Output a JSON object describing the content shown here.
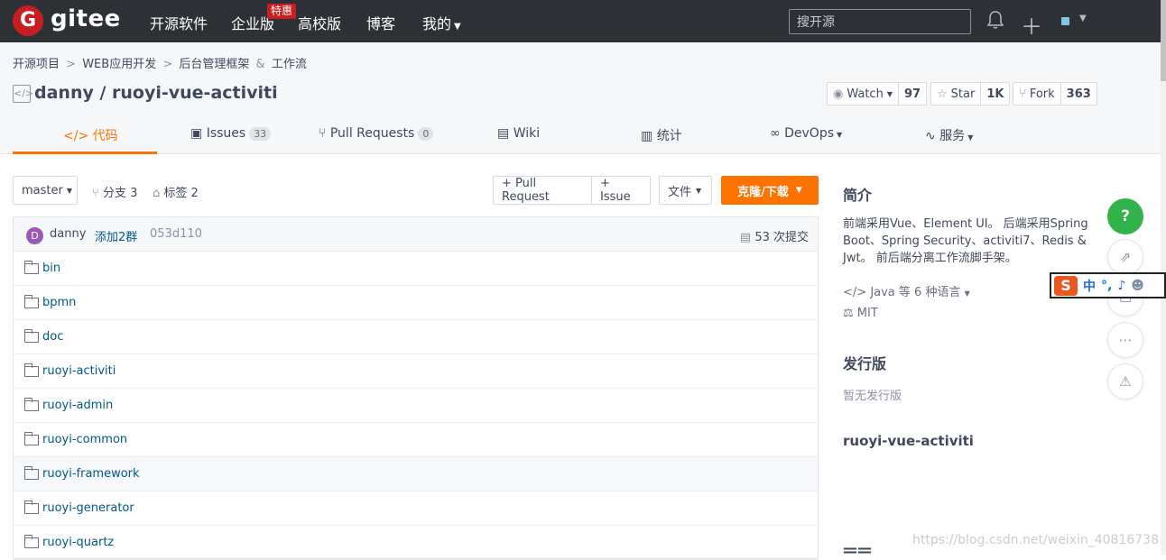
{
  "navbar": {
    "logo_text": "gitee",
    "items": [
      "开源软件",
      "企业版",
      "高校版",
      "博客",
      "我的"
    ],
    "badge": "特惠",
    "search_placeholder": "搜开源"
  },
  "breadcrumb": [
    "开源项目",
    "WEB应用开发",
    "后台管理框架",
    "工作流"
  ],
  "breadcrumb_amp": "&",
  "repo": {
    "title": "danny / ruoyi-vue-activiti",
    "watch_label": "Watch",
    "watch_count": "97",
    "star_label": "Star",
    "star_count": "1K",
    "fork_label": "Fork",
    "fork_count": "363"
  },
  "tabs": [
    {
      "label": "代码",
      "count": ""
    },
    {
      "label": "Issues",
      "count": "33"
    },
    {
      "label": "Pull Requests",
      "count": "0"
    },
    {
      "label": "Wiki",
      "count": ""
    },
    {
      "label": "统计",
      "count": ""
    },
    {
      "label": "DevOps",
      "count": ""
    },
    {
      "label": "服务",
      "count": ""
    }
  ],
  "branch": {
    "current": "master",
    "branches": "分支 3",
    "tags": "标签 2",
    "pull_request": "+ Pull Request",
    "issue": "+ Issue",
    "file": "文件",
    "clone": "克隆/下载"
  },
  "commit": {
    "avatar_letter": "D",
    "author": "danny",
    "message": "添加2群",
    "sha": "053d110",
    "count": "53 次提交"
  },
  "files": [
    "bin",
    "bpmn",
    "doc",
    "ruoyi-activiti",
    "ruoyi-admin",
    "ruoyi-common",
    "ruoyi-framework",
    "ruoyi-generator",
    "ruoyi-quartz"
  ],
  "sidebar": {
    "intro_title": "简介",
    "intro": "前端采用Vue、Element UI。 后端采用Spring Boot、Spring Security、activiti7、Redis & Jwt。 前后端分离工作流脚手架。",
    "language": "Java 等 6 种语言",
    "license": "MIT",
    "release_title": "发行版",
    "release_empty": "暂无发行版",
    "project_name": "ruoyi-vue-activiti"
  },
  "ime": {
    "lang": "中",
    "punct": "°,"
  },
  "watermark": "https://blog.csdn.net/weixin_40816738",
  "colors": {
    "accent": "#fe7300",
    "navbar": "#2d3035",
    "link": "#005980",
    "help": "#2fb34a"
  }
}
